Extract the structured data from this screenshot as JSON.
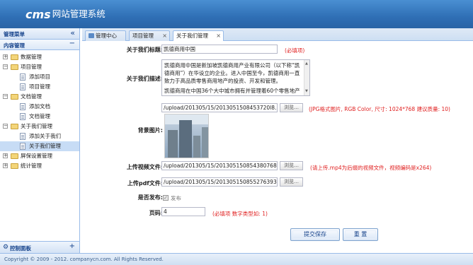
{
  "app": {
    "logo_cms": "cms",
    "logo_title": "网站管理系统"
  },
  "sidebar": {
    "title": "管理菜单",
    "collapse_icon": "«",
    "section_title": "内容管理",
    "section_toggle": "−",
    "tree": [
      {
        "label": "数据管理",
        "type": "folder",
        "level": 0,
        "toggle": "+"
      },
      {
        "label": "项目管理",
        "type": "folder",
        "level": 0,
        "toggle": "−"
      },
      {
        "label": "添加项目",
        "type": "leaf",
        "level": 1
      },
      {
        "label": "项目管理",
        "type": "leaf",
        "level": 1
      },
      {
        "label": "文档管理",
        "type": "folder",
        "level": 0,
        "toggle": "−"
      },
      {
        "label": "添加文档",
        "type": "leaf",
        "level": 1
      },
      {
        "label": "文档管理",
        "type": "leaf",
        "level": 1
      },
      {
        "label": "关于我们管理",
        "type": "folder",
        "level": 0,
        "toggle": "−"
      },
      {
        "label": "添加关于我们",
        "type": "leaf",
        "level": 1
      },
      {
        "label": "关于我们管理",
        "type": "leaf",
        "level": 1,
        "selected": true
      },
      {
        "label": "屏保设置管理",
        "type": "folder",
        "level": 0,
        "toggle": "+"
      },
      {
        "label": "统计管理",
        "type": "folder",
        "level": 0,
        "toggle": "+"
      }
    ],
    "footer_title": "控制面板",
    "footer_plus": "+"
  },
  "tabs": [
    {
      "label": "管理中心",
      "closable": false,
      "active": false,
      "home": true
    },
    {
      "label": "项目管理",
      "closable": true,
      "active": false
    },
    {
      "label": "关于我们管理",
      "closable": true,
      "active": true
    }
  ],
  "form": {
    "title_label": "关于我们标题:",
    "title_value": "凯德商用中国",
    "title_hint": "(必填项)",
    "desc_label": "关于我们描述:",
    "desc_p1": "凯德商用中国是新加坡凯德商用产业有限公司（以下称“凯德商用”）在华设立的企业。进入中国至今，凯德商用一直致力于高品质零售商用地产的投资、开发和管理。",
    "desc_p2": "凯德商用在中国36个大中城市拥有并管理着60个零售地产项",
    "bg_label": "背景图片:",
    "bg_path": "/upload/201305/15/2013051508453720l8.pn",
    "bg_hint": "(JPG格式图片, RGB Color, 尺寸: 1024*768 建议质量: 10)",
    "video_label": "上传视频文件:",
    "video_path": "/upload/201305/15/201305150854380768.m",
    "video_hint": "(请上传.mp4为后缀的视频文件，视频编码是x264)",
    "pdf_label": "上传pdf文件:",
    "pdf_path": "/upload/201305/15/201305150855276393.pd",
    "browse_label": "浏览…",
    "publish_label": "是否发布:",
    "publish_text": "发布",
    "publish_checked": true,
    "order_label": "页码:",
    "order_value": "4",
    "order_hint": "(必填项 数字类型如: 1)",
    "submit_label": "提交保存",
    "reset_label": "重 置"
  },
  "footer": {
    "copyright": "Copyright © 2009 - 2012. companycn.com. All Rights Reserved."
  }
}
